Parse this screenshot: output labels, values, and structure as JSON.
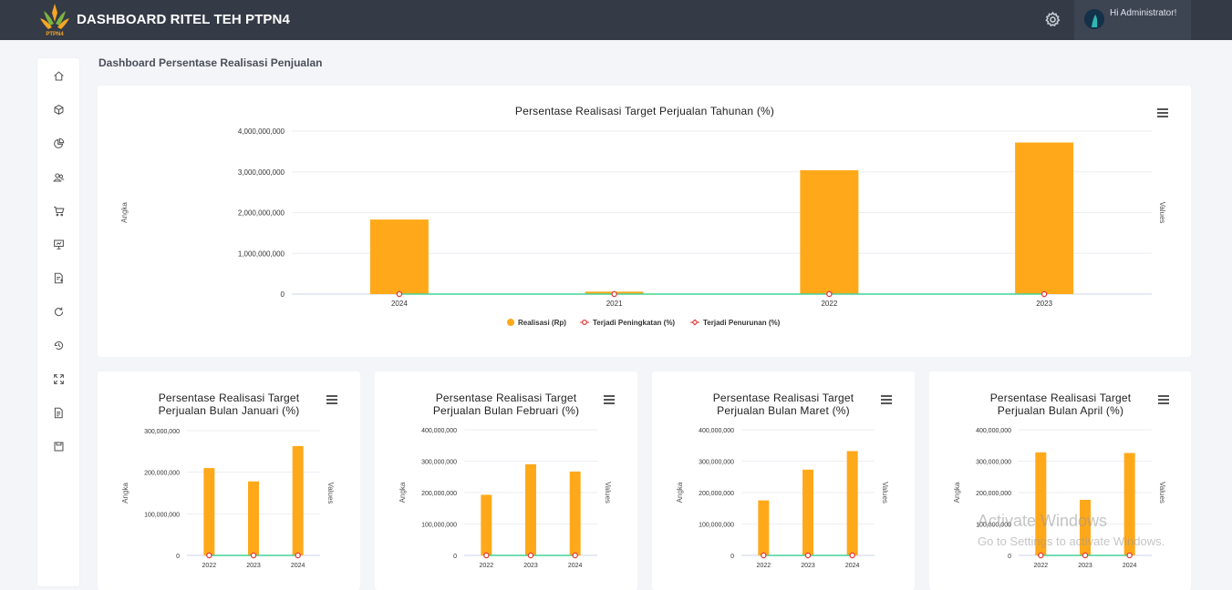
{
  "header": {
    "brand": "DASHBOARD RITEL TEH PTPN4",
    "logo_text": "PTPN4",
    "user_greeting": "Hi Administrator!"
  },
  "sidebar": {
    "items": [
      {
        "icon": "home-icon"
      },
      {
        "icon": "box-icon"
      },
      {
        "icon": "pie-chart-icon"
      },
      {
        "icon": "users-icon"
      },
      {
        "icon": "cart-icon"
      },
      {
        "icon": "presentation-icon"
      },
      {
        "icon": "document-edit-icon"
      },
      {
        "icon": "refresh-icon"
      },
      {
        "icon": "history-icon"
      },
      {
        "icon": "expand-icon"
      },
      {
        "icon": "file-icon"
      },
      {
        "icon": "save-icon"
      }
    ]
  },
  "page": {
    "title": "Dashboard Persentase Realisasi Penjualan"
  },
  "watermark": {
    "line1": "Activate Windows",
    "line2": "Go to Settings to activate Windows."
  },
  "colors": {
    "bar": "#ffa91a",
    "line": "#45d29a",
    "marker": "#e23a3a"
  },
  "chart_data": [
    {
      "type": "bar",
      "title": "Persentase Realisasi Target Perjualan Tahunan (%)",
      "ylabel": "Angka",
      "y2label": "Values",
      "ylim": [
        0,
        4000000000
      ],
      "yticks": [
        "0",
        "1,000,000,000",
        "2,000,000,000",
        "3,000,000,000",
        "4,000,000,000"
      ],
      "categories": [
        "2024",
        "2021",
        "2022",
        "2023"
      ],
      "series": [
        {
          "name": "Realisasi (Rp)",
          "values": [
            1830000000,
            60000000,
            3040000000,
            3720000000
          ]
        },
        {
          "name": "Terjadi Peningkatan (%)",
          "values": [
            0,
            0,
            0,
            0
          ]
        },
        {
          "name": "Terjadi Penurunan (%)",
          "values": [
            0,
            0,
            0,
            0
          ]
        }
      ],
      "legend": "bottom-center"
    },
    {
      "type": "bar",
      "title_line1": "Persentase Realisasi Target",
      "title_line2": "Perjualan Bulan Januari (%)",
      "ylabel": "Angka",
      "y2label": "Values",
      "ylim": [
        0,
        300000000
      ],
      "yticks": [
        "0",
        "100,000,000",
        "200,000,000",
        "300,000,000"
      ],
      "categories": [
        "2022",
        "2023",
        "2024"
      ],
      "values": [
        210000000,
        178000000,
        263000000
      ]
    },
    {
      "type": "bar",
      "title_line1": "Persentase Realisasi Target",
      "title_line2": "Perjualan Bulan Februari (%)",
      "ylabel": "Angka",
      "y2label": "Values",
      "ylim": [
        0,
        400000000
      ],
      "yticks": [
        "0",
        "100,000,000",
        "200,000,000",
        "300,000,000",
        "400,000,000"
      ],
      "categories": [
        "2022",
        "2023",
        "2024"
      ],
      "values": [
        193000000,
        290000000,
        267000000
      ]
    },
    {
      "type": "bar",
      "title_line1": "Persentase Realisasi Target",
      "title_line2": "Perjualan Bulan Maret (%)",
      "ylabel": "Angka",
      "y2label": "Values",
      "ylim": [
        0,
        400000000
      ],
      "yticks": [
        "0",
        "100,000,000",
        "200,000,000",
        "300,000,000",
        "400,000,000"
      ],
      "categories": [
        "2022",
        "2023",
        "2024"
      ],
      "values": [
        175000000,
        273000000,
        332000000
      ]
    },
    {
      "type": "bar",
      "title_line1": "Persentase Realisasi Target",
      "title_line2": "Perjualan Bulan April (%)",
      "ylabel": "Angka",
      "y2label": "Values",
      "ylim": [
        0,
        400000000
      ],
      "yticks": [
        "0",
        "100,000,000",
        "200,000,000",
        "300,000,000",
        "400,000,000"
      ],
      "categories": [
        "2022",
        "2023",
        "2024"
      ],
      "values": [
        328000000,
        177000000,
        326000000
      ]
    }
  ]
}
